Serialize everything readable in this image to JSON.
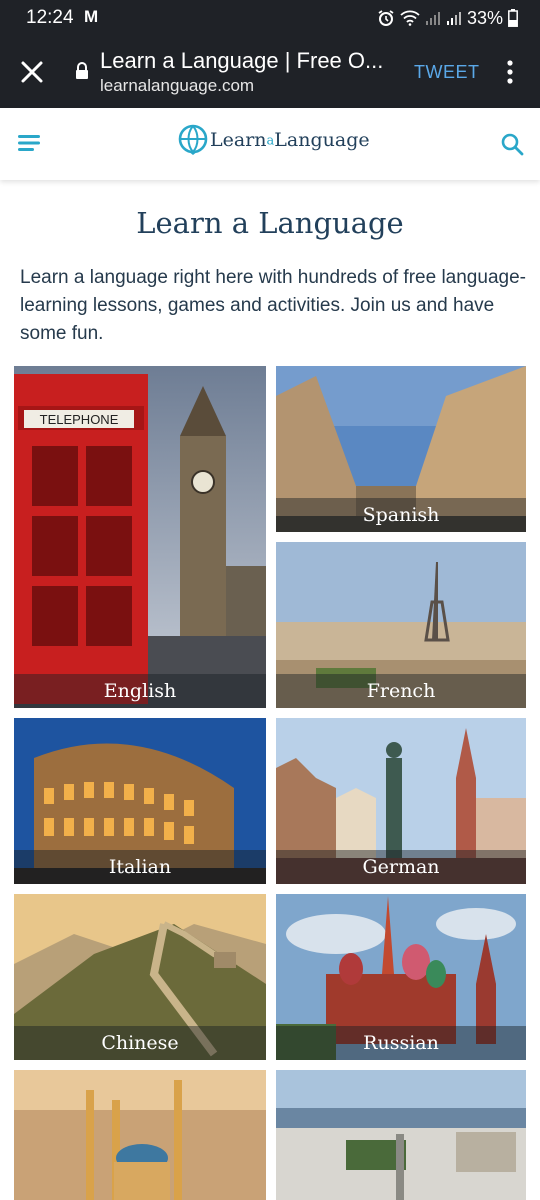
{
  "status_bar": {
    "time": "12:24",
    "gmail_icon": "M",
    "battery": "33%"
  },
  "browser": {
    "title": "Learn a Language | Free O...",
    "url": "learnalanguage.com",
    "tweet_label": "TWEET"
  },
  "site_header": {
    "logo_part1": "Learn",
    "logo_part2": "a",
    "logo_part3": "Language"
  },
  "main": {
    "heading": "Learn a Language",
    "intro": "Learn a language right here with hundreds of free language-learning lessons, games and activities. Join us and have some fun.",
    "languages": [
      {
        "label": "English"
      },
      {
        "label": "Spanish"
      },
      {
        "label": "French"
      },
      {
        "label": "Italian"
      },
      {
        "label": "German"
      },
      {
        "label": "Chinese"
      },
      {
        "label": "Russian"
      }
    ]
  },
  "colors": {
    "accent": "#2aa7c9",
    "heading": "#22405b",
    "bar": "#1f2227"
  }
}
